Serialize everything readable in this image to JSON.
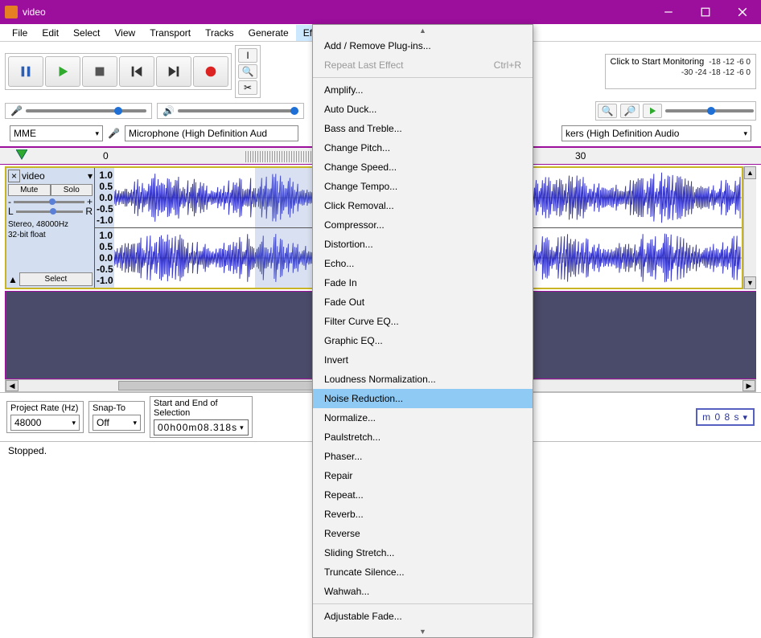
{
  "window": {
    "title": "video"
  },
  "menubar": {
    "items": [
      "File",
      "Edit",
      "Select",
      "View",
      "Transport",
      "Tracks",
      "Generate",
      "Effect"
    ],
    "activeIndex": 7
  },
  "transport": {
    "buttons": [
      "pause",
      "play",
      "stop",
      "skip-start",
      "skip-end",
      "record"
    ]
  },
  "meters": {
    "recordText": "Click to Start Monitoring",
    "recTicks": [
      "-18",
      "-12",
      "-6",
      "0"
    ],
    "playTicks": [
      "-30",
      "-24",
      "-18",
      "-12",
      "-6",
      "0"
    ]
  },
  "devices": {
    "host": "MME",
    "input": "Microphone (High Definition Aud",
    "output": "kers (High Definition Audio"
  },
  "timeline": {
    "t0": "0",
    "t30": "30"
  },
  "track": {
    "name": "video",
    "mute": "Mute",
    "solo": "Solo",
    "panL": "L",
    "panR": "R",
    "gainMinus": "-",
    "gainPlus": "+",
    "info1": "Stereo, 48000Hz",
    "info2": "32-bit float",
    "select": "Select",
    "scale": [
      "1.0",
      "0.5",
      "0.0",
      "-0.5",
      "-1.0"
    ]
  },
  "selectionbar": {
    "rateLabel": "Project Rate (Hz)",
    "rate": "48000",
    "snapLabel": "Snap-To",
    "snap": "Off",
    "seLabel": "Start and End of Selection",
    "start": "00h00m08.318s",
    "rightcounter": "m 0 8 s"
  },
  "status": {
    "text": "Stopped."
  },
  "effectMenu": {
    "top": [
      {
        "label": "Add / Remove Plug-ins...",
        "enabled": true
      },
      {
        "label": "Repeat Last Effect",
        "enabled": false,
        "accel": "Ctrl+R"
      }
    ],
    "items": [
      "Amplify...",
      "Auto Duck...",
      "Bass and Treble...",
      "Change Pitch...",
      "Change Speed...",
      "Change Tempo...",
      "Click Removal...",
      "Compressor...",
      "Distortion...",
      "Echo...",
      "Fade In",
      "Fade Out",
      "Filter Curve EQ...",
      "Graphic EQ...",
      "Invert",
      "Loudness Normalization...",
      "Noise Reduction...",
      "Normalize...",
      "Paulstretch...",
      "Phaser...",
      "Repair",
      "Repeat...",
      "Reverb...",
      "Reverse",
      "Sliding Stretch...",
      "Truncate Silence...",
      "Wahwah..."
    ],
    "highlightedIndex": 16,
    "bottom": [
      "Adjustable Fade..."
    ]
  }
}
